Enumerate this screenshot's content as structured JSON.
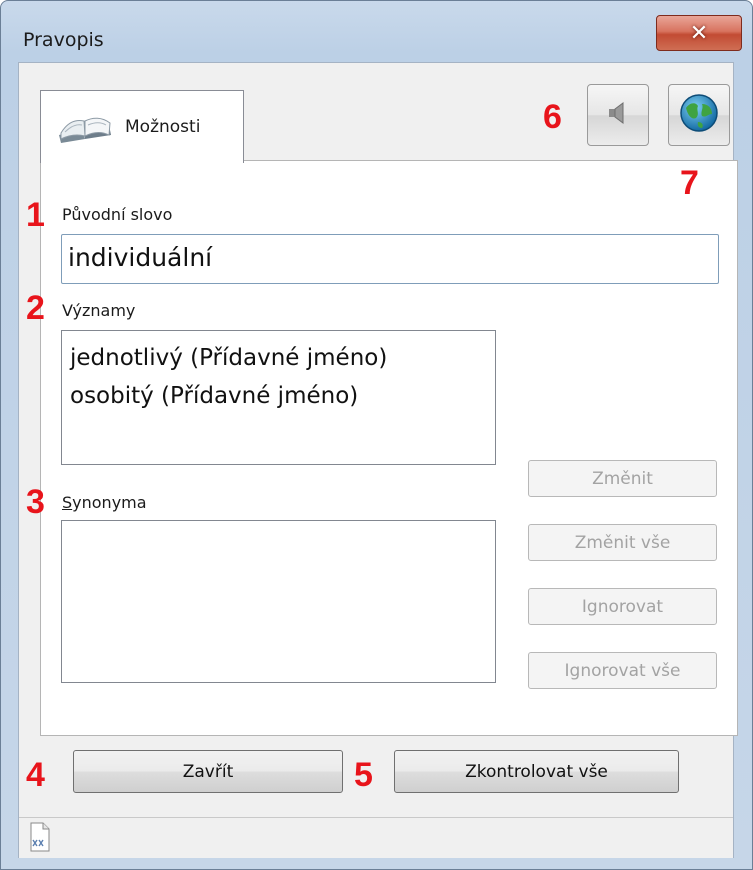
{
  "window": {
    "title": "Pravopis",
    "close_symbol": "✕"
  },
  "tab": {
    "label": "Možnosti",
    "icon": "book-icon"
  },
  "toolbar": {
    "speaker_icon": "speaker-icon",
    "globe_icon": "globe-icon"
  },
  "original_word": {
    "label": "Původní slovo",
    "value": "individuální"
  },
  "meanings": {
    "label": "Významy",
    "items": [
      "jednotlivý (Přídavné jméno)",
      "osobitý (Přídavné jméno)"
    ]
  },
  "synonyms": {
    "label_first": "S",
    "label_rest": "ynonyma",
    "items": []
  },
  "side_buttons": {
    "change": "Změnit",
    "change_all": "Změnit vše",
    "ignore": "Ignorovat",
    "ignore_all": "Ignorovat vše"
  },
  "bottom_buttons": {
    "close": "Zavřít",
    "check_all": "Zkontrolovat vše"
  },
  "markers": [
    "1",
    "2",
    "3",
    "4",
    "5",
    "6",
    "7"
  ],
  "colors": {
    "marker_red": "#e8141b",
    "close_button": "#c24b33"
  }
}
